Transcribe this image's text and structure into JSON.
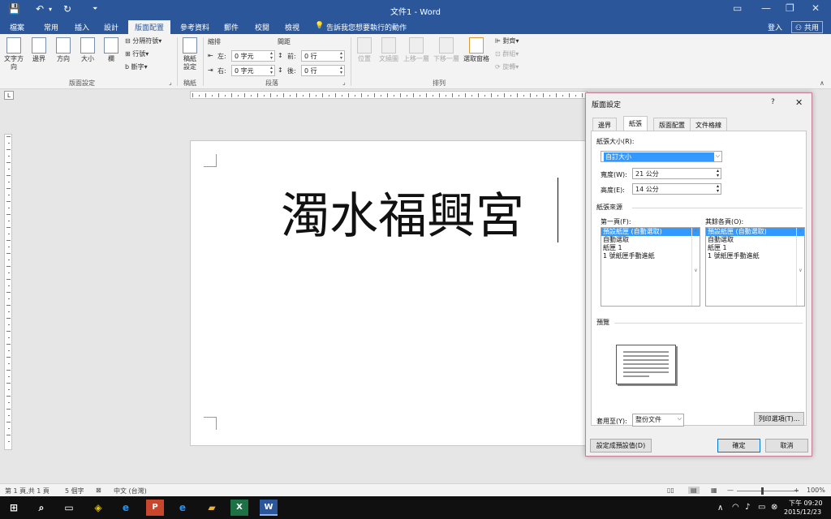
{
  "titlebar": {
    "title": "文件1 - Word",
    "save_icon": "💾",
    "undo_icon": "↶",
    "redo_icon": "↻",
    "customize_icon": "⏷",
    "ribbon_opts_icon": "▭",
    "minimize": "—",
    "maximize": "❐",
    "close": "✕"
  },
  "tabs": [
    "檔案",
    "常用",
    "插入",
    "設計",
    "版面配置",
    "參考資料",
    "郵件",
    "校閱",
    "檢視"
  ],
  "tellme": "告訴我您想要執行的動作",
  "signin": "登入",
  "share": "共用",
  "ribbon": {
    "text_direction": "文字方向",
    "margins": "邊界",
    "orientation": "方向",
    "size": "大小",
    "columns": "欄",
    "breaks": "分隔符號",
    "line_numbers": "行號",
    "hyphenation": "斷字",
    "page_setup_group": "版面設定",
    "draft_paper": "稿紙設定",
    "draft_group": "稿紙",
    "indent_label": "縮排",
    "indent_left_label": "左:",
    "indent_left_value": "0 字元",
    "indent_right_label": "右:",
    "indent_right_value": "0 字元",
    "spacing_label": "間距",
    "spacing_before_label": "前:",
    "spacing_before_value": "0 行",
    "spacing_after_label": "後:",
    "spacing_after_value": "0 行",
    "paragraph_group": "段落",
    "position": "位置",
    "wrap_text": "文繞圖",
    "bring_forward": "上移一層",
    "send_backward": "下移一層",
    "selection_pane": "選取窗格",
    "align": "對齊",
    "group": "群組",
    "rotate": "旋轉",
    "arrange_group": "排列"
  },
  "document": {
    "text": "濁水福興宮"
  },
  "dialog": {
    "title": "版面設定",
    "help": "?",
    "close": "✕",
    "tabs": [
      "邊界",
      "紙張",
      "版面配置",
      "文件格線"
    ],
    "paper_size_label": "紙張大小(R):",
    "paper_size_value": "自訂大小",
    "width_label": "寬度(W):",
    "width_value": "21 公分",
    "height_label": "高度(E):",
    "height_value": "14 公分",
    "paper_source_label": "紙張來源",
    "first_page_label": "第一頁(F):",
    "other_pages_label": "其餘各頁(O):",
    "tray_options": [
      "預設紙匣 (自動選取)",
      "自動選取",
      "紙匣 1",
      "1 號紙匣手動進紙"
    ],
    "preview_label": "預覽",
    "apply_to_label": "套用至(Y):",
    "apply_to_value": "整份文件",
    "print_options": "列印選項(T)...",
    "set_default": "設定成預設值(D)",
    "ok": "確定",
    "cancel": "取消"
  },
  "status": {
    "page": "第 1 頁,共 1 頁",
    "words": "5 個字",
    "lang": "中文 (台灣)",
    "zoom": "100%"
  },
  "tray": {
    "time": "下午 09:20",
    "date": "2015/12/23",
    "up_icon": "∧",
    "wifi_icon": "◠",
    "volume_icon": "♪",
    "message_icon": "▭",
    "disconnect_icon": "⊗"
  }
}
